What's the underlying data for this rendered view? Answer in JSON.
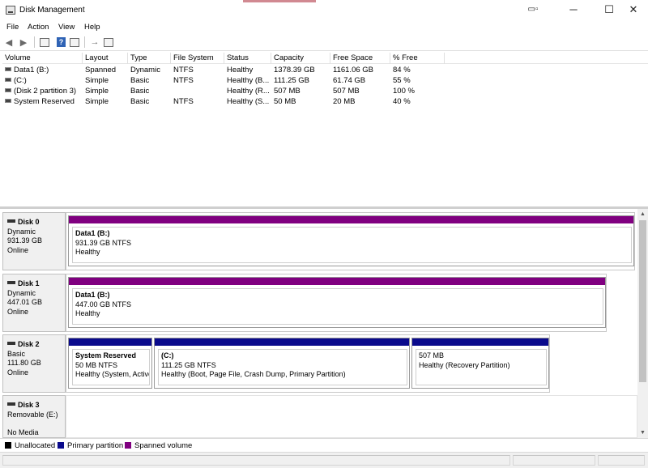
{
  "window": {
    "title": "Disk Management",
    "minimize_glyph": "─",
    "maximize_glyph": "☐",
    "close_glyph": "✕",
    "snap_glyph": "▭▫"
  },
  "menu": [
    "File",
    "Action",
    "View",
    "Help"
  ],
  "toolbar": {
    "back_icon": "arrow-left-icon",
    "forward_icon": "arrow-right-icon",
    "properties_icon": "properties-icon",
    "help_icon": "help-icon",
    "help_glyph": "?",
    "view_icon": "view-icon",
    "connect_icon": "connect-icon",
    "list_icon": "list-icon"
  },
  "volume_list": {
    "columns": [
      "Volume",
      "Layout",
      "Type",
      "File System",
      "Status",
      "Capacity",
      "Free Space",
      "% Free"
    ],
    "rows": [
      [
        "Data1 (B:)",
        "Spanned",
        "Dynamic",
        "NTFS",
        "Healthy",
        "1378.39 GB",
        "1161.06 GB",
        "84 %"
      ],
      [
        "(C:)",
        "Simple",
        "Basic",
        "NTFS",
        "Healthy (B...",
        "111.25 GB",
        "61.74 GB",
        "55 %"
      ],
      [
        "(Disk 2 partition 3)",
        "Simple",
        "Basic",
        "",
        "Healthy (R...",
        "507 MB",
        "507 MB",
        "100 %"
      ],
      [
        "System Reserved",
        "Simple",
        "Basic",
        "NTFS",
        "Healthy (S...",
        "50 MB",
        "20 MB",
        "40 %"
      ]
    ]
  },
  "disks": [
    {
      "name": "Disk 0",
      "type": "Dynamic",
      "size": "931.39 GB",
      "state": "Online",
      "partitions": [
        {
          "name": "Data1  (B:)",
          "size_fs": "931.39 GB NTFS",
          "status": "Healthy",
          "kind": "spanned"
        }
      ]
    },
    {
      "name": "Disk 1",
      "type": "Dynamic",
      "size": "447.01 GB",
      "state": "Online",
      "partitions": [
        {
          "name": "Data1  (B:)",
          "size_fs": "447.00 GB NTFS",
          "status": "Healthy",
          "kind": "spanned"
        }
      ]
    },
    {
      "name": "Disk 2",
      "type": "Basic",
      "size": "111.80 GB",
      "state": "Online",
      "partitions": [
        {
          "name": "System Reserved",
          "size_fs": "50 MB NTFS",
          "status": "Healthy (System, Active",
          "kind": "primary"
        },
        {
          "name": "(C:)",
          "size_fs": "111.25 GB NTFS",
          "status": "Healthy (Boot, Page File, Crash Dump, Primary Partition)",
          "kind": "primary"
        },
        {
          "name": "",
          "size_fs": "507 MB",
          "status": "Healthy (Recovery Partition)",
          "kind": "primary"
        }
      ]
    },
    {
      "name": "Disk 3",
      "type": "Removable (E:)",
      "size": "",
      "state": "No Media",
      "partitions": []
    }
  ],
  "legend": [
    {
      "label": "Unallocated",
      "color": "#000000"
    },
    {
      "label": "Primary partition",
      "color": "#0a0a8c"
    },
    {
      "label": "Spanned volume",
      "color": "#800080"
    }
  ],
  "colors": {
    "spanned": "#800080",
    "primary": "#0a0a8c"
  }
}
